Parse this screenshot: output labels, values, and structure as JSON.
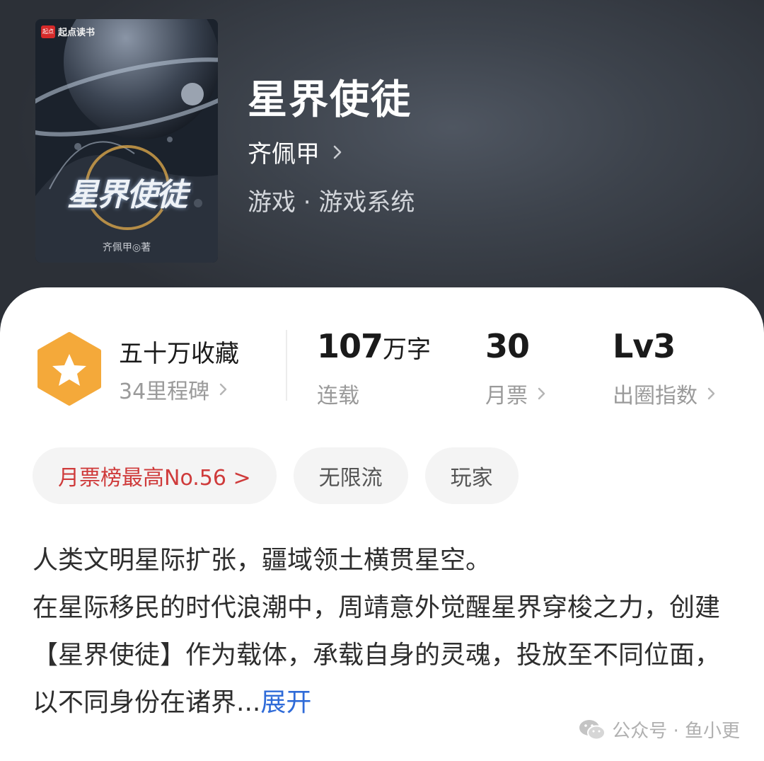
{
  "book": {
    "title": "星界使徒",
    "author": "齐佩甲",
    "genre": "游戏 · 游戏系统",
    "cover": {
      "logo_box": "起点",
      "logo_text": "起点读书",
      "title": "星界使徒",
      "author_line": "齐佩甲◎著"
    }
  },
  "stats": {
    "collection": {
      "main": "五十万收藏",
      "sub": "34里程碑"
    },
    "words": {
      "number": "107",
      "unit": "万字",
      "label": "连载"
    },
    "monthly_votes": {
      "value": "30",
      "label": "月票"
    },
    "influence": {
      "value": "Lv3",
      "label": "出圈指数"
    }
  },
  "tags": [
    "月票榜最高No.56 >",
    "无限流",
    "玩家"
  ],
  "description": {
    "line1": "人类文明星际扩张，疆域领土横贯星空。",
    "line2": "在星际移民的时代浪潮中，周靖意外觉醒星界穿梭之力，创建【星界使徒】作为载体，承载自身的灵魂，投放至不同位面，以不同身份在诸界...",
    "expand": "展开"
  },
  "watermark": "公众号 · 鱼小更",
  "colors": {
    "accent_blue": "#2f6bd8",
    "rank_red": "#cf3b3b",
    "badge_orange": "#f4a93a"
  }
}
